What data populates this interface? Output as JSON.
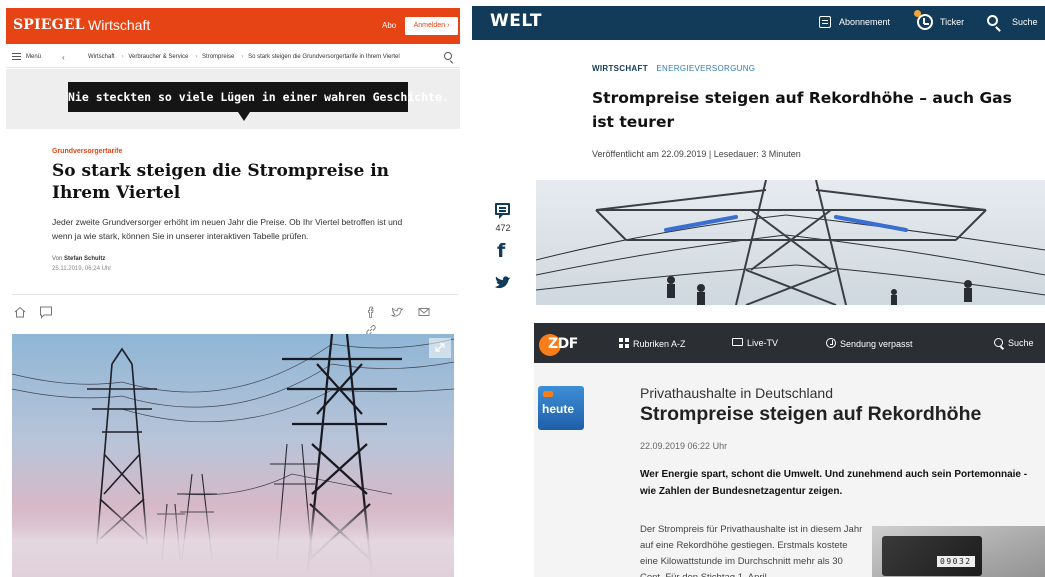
{
  "spiegel": {
    "logo": "SPIEGEL",
    "section": "Wirtschaft",
    "abo": "Abo",
    "login": "Anmelden",
    "menu": "Menü",
    "breadcrumbs": [
      "Wirtschaft",
      "Verbraucher & Service",
      "Strompreise",
      "So stark steigen die Grundversorgertarife in Ihrem Viertel"
    ],
    "ad_text": "Nie steckten so viele Lügen in einer wahren Geschichte.",
    "kicker": "Grundversorgertarife",
    "title": "So stark steigen die Strompreise in Ihrem Viertel",
    "teaser": "Jeder zweite Grundversorger erhöht im neuen Jahr die Preise. Ob Ihr Viertel betroffen ist und wenn ja wie stark, können Sie in unserer interaktiven Tabelle prüfen.",
    "author_prefix": "Von",
    "author": "Stefan Schultz",
    "date": "25.11.2019, 06:24 Uhr",
    "colors": {
      "brand": "#e64415"
    }
  },
  "welt": {
    "logo": "WELT",
    "abo": "Abonnement",
    "ticker": "Ticker",
    "search": "Suche",
    "kicker_1": "WIRTSCHAFT",
    "kicker_2": "ENERGIEVERSORGUNG",
    "title": "Strompreise steigen auf Rekordhöhe – auch Gas ist teurer",
    "meta": "Veröffentlicht am 22.09.2019 | Lesedauer: 3 Minuten",
    "comment_count": "472",
    "colors": {
      "brand": "#123b59",
      "accent": "#2f7fb3",
      "ticker_dot": "#f2a33a"
    }
  },
  "zdf": {
    "logo": "ZDF",
    "nav": [
      "Rubriken A-Z",
      "Live-TV",
      "Sendung verpasst",
      "Suche"
    ],
    "heute": "heute",
    "subtitle": "Privathaushalte in Deutschland",
    "title": "Strompreise steigen auf Rekordhöhe",
    "date": "22.09.2019 06:22 Uhr",
    "lead": "Wer Energie spart, schont die Umwelt. Und zunehmend auch sein Portemonnaie - wie Zahlen der Bundesnetzagentur zeigen.",
    "body": "Der Strompreis für Privathaushalte ist in diesem Jahr auf eine Rekordhöhe gestiegen. Erstmals kostete eine Kilowattstunde im Durchschnitt mehr als 30 Cent. Für den Stichtag 1. April",
    "meter_digits": "09032",
    "colors": {
      "brand": "#fa7d19",
      "header": "#2b2e33"
    }
  }
}
